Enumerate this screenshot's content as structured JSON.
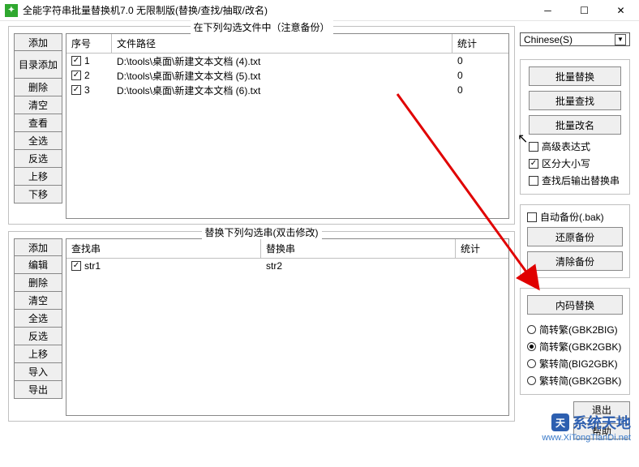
{
  "window": {
    "title": "全能字符串批量替换机7.0 无限制版(替换/查找/抽取/改名)"
  },
  "top_panel": {
    "legend": "在下列勾选文件中（注意备份）",
    "buttons": [
      "添加",
      "目录添加",
      "删除",
      "清空",
      "查看",
      "全选",
      "反选",
      "上移",
      "下移"
    ],
    "headers": {
      "seq": "序号",
      "path": "文件路径",
      "count": "统计"
    },
    "col_widths": {
      "seq": 56,
      "path": 420,
      "count": 60
    },
    "rows": [
      {
        "checked": true,
        "seq": "1",
        "path": "D:\\tools\\桌面\\新建文本文档 (4).txt",
        "count": "0"
      },
      {
        "checked": true,
        "seq": "2",
        "path": "D:\\tools\\桌面\\新建文本文档 (5).txt",
        "count": "0"
      },
      {
        "checked": true,
        "seq": "3",
        "path": "D:\\tools\\桌面\\新建文本文档 (6).txt",
        "count": "0"
      }
    ]
  },
  "bottom_panel": {
    "legend": "替换下列勾选串(双击修改)",
    "buttons": [
      "添加",
      "编辑",
      "删除",
      "清空",
      "全选",
      "反选",
      "上移",
      "导入",
      "导出"
    ],
    "headers": {
      "find": "查找串",
      "replace": "替换串",
      "count": "统计"
    },
    "col_widths": {
      "find": 240,
      "replace": 240,
      "count": 60
    },
    "rows": [
      {
        "checked": true,
        "find": "str1",
        "replace": "str2",
        "count": ""
      }
    ]
  },
  "right": {
    "encoding": "Chinese(S)",
    "batch_replace": "批量替换",
    "batch_find": "批量查找",
    "batch_rename": "批量改名",
    "adv_expr": {
      "label": "高级表达式",
      "checked": false
    },
    "case_sensitive": {
      "label": "区分大小写",
      "checked": true
    },
    "output_on_find": {
      "label": "查找后输出替换串",
      "checked": false
    },
    "auto_backup": {
      "label": "自动备份(.bak)",
      "checked": false
    },
    "restore_backup": "还原备份",
    "clear_backup": "清除备份",
    "code_replace": "内码替换",
    "radios": [
      {
        "label": "简转繁(GBK2BIG)",
        "selected": false
      },
      {
        "label": "简转繁(GBK2GBK)",
        "selected": true
      },
      {
        "label": "繁转简(BIG2GBK)",
        "selected": false
      },
      {
        "label": "繁转简(GBK2GBK)",
        "selected": false
      }
    ],
    "exit": "退出",
    "help": "帮助"
  },
  "watermark": {
    "brand": "系统天地",
    "url": "www.XiTongTianDi.net"
  }
}
